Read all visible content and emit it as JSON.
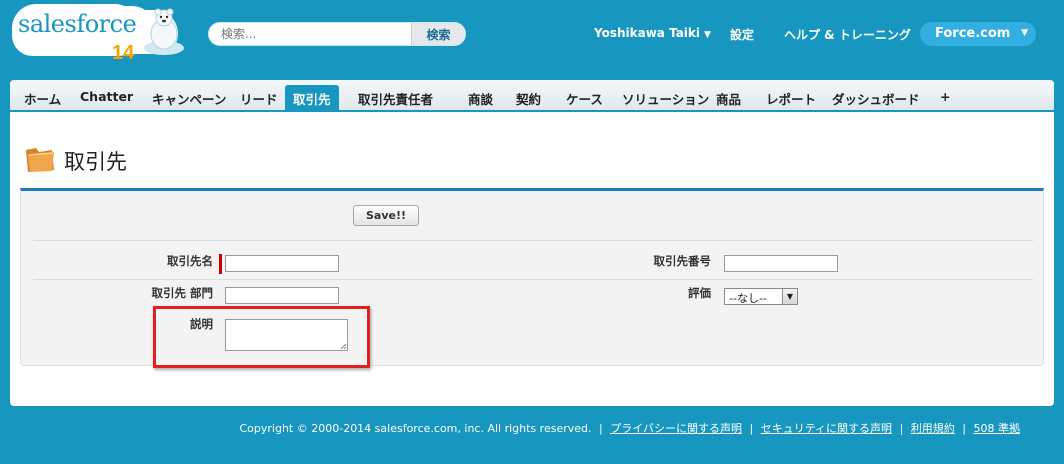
{
  "header": {
    "logo": {
      "text": "salesforce",
      "number": "14"
    },
    "search": {
      "placeholder": "検索...",
      "button_label": "検索"
    },
    "user_menu": {
      "label": "Yoshikawa Taiki",
      "caret": "▼"
    },
    "setup_label": "設定",
    "help_label": "ヘルプ & トレーニング",
    "app_menu": {
      "label": "Force.com",
      "caret": "▼"
    }
  },
  "tabs": [
    {
      "label": "ホーム",
      "active": false
    },
    {
      "label": "Chatter",
      "active": false
    },
    {
      "label": "キャンペーン",
      "active": false
    },
    {
      "label": "リード",
      "active": false
    },
    {
      "label": "取引先",
      "active": true
    },
    {
      "label": "取引先責任者",
      "active": false
    },
    {
      "label": "商談",
      "active": false
    },
    {
      "label": "契約",
      "active": false
    },
    {
      "label": "ケース",
      "active": false
    },
    {
      "label": "ソリューション",
      "active": false
    },
    {
      "label": "商品",
      "active": false
    },
    {
      "label": "レポート",
      "active": false
    },
    {
      "label": "ダッシュボード",
      "active": false
    },
    {
      "label": "+",
      "active": false
    }
  ],
  "page": {
    "title": "取引先",
    "icon": "folder-icon"
  },
  "form": {
    "save_label": "Save!!",
    "fields": {
      "account_name": {
        "label": "取引先名",
        "value": "",
        "required": true
      },
      "account_number": {
        "label": "取引先番号",
        "value": ""
      },
      "division": {
        "label": "取引先 部門",
        "value": ""
      },
      "rating": {
        "label": "評価",
        "selected": "--なし--"
      },
      "description": {
        "label": "説明",
        "value": ""
      }
    }
  },
  "footer": {
    "copyright": "Copyright © 2000-2014 salesforce.com, inc. All rights reserved.",
    "links": [
      "プライバシーに関する声明",
      "セキュリティに関する声明",
      "利用規約",
      "508 準拠"
    ]
  },
  "colors": {
    "brand_blue": "#1797c0",
    "active_tab": "#1797c0",
    "required": "#cc0000",
    "highlight": "#e02020",
    "logo_number": "#f2a400"
  }
}
